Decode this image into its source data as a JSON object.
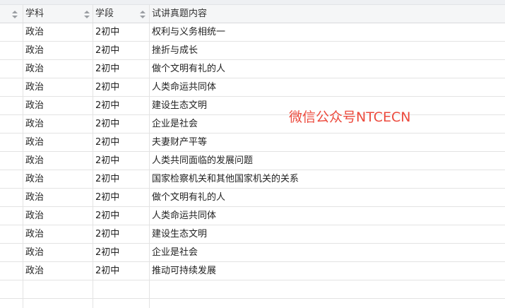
{
  "table": {
    "columns": [
      "",
      "学科",
      "学段",
      "试讲真题内容"
    ],
    "rows": [
      {
        "subject": "政治",
        "level": "2初中",
        "topic": "权利与义务相统一"
      },
      {
        "subject": "政治",
        "level": "2初中",
        "topic": "挫折与成长"
      },
      {
        "subject": "政治",
        "level": "2初中",
        "topic": "做个文明有礼的人"
      },
      {
        "subject": "政治",
        "level": "2初中",
        "topic": "人类命运共同体"
      },
      {
        "subject": "政治",
        "level": "2初中",
        "topic": "建设生态文明"
      },
      {
        "subject": "政治",
        "level": "2初中",
        "topic": "企业是社会"
      },
      {
        "subject": "政治",
        "level": "2初中",
        "topic": "夫妻财产平等"
      },
      {
        "subject": "政治",
        "level": "2初中",
        "topic": "人类共同面临的发展问题"
      },
      {
        "subject": "政治",
        "level": "2初中",
        "topic": "国家检察机关和其他国家机关的关系"
      },
      {
        "subject": "政治",
        "level": "2初中",
        "topic": "做个文明有礼的人"
      },
      {
        "subject": "政治",
        "level": "2初中",
        "topic": "人类命运共同体"
      },
      {
        "subject": "政治",
        "level": "2初中",
        "topic": "建设生态文明"
      },
      {
        "subject": "政治",
        "level": "2初中",
        "topic": "企业是社会"
      },
      {
        "subject": "政治",
        "level": "2初中",
        "topic": "推动可持续发展"
      }
    ],
    "empty_rows": 2
  },
  "watermark": "微信公众号NTCECN",
  "colors": {
    "header_bg": "#f5f6f7",
    "grid_line": "#e3e3e3",
    "watermark": "#ec4a3d",
    "sort_icon": "#9a9da2"
  },
  "icons": [
    "sort-icon"
  ]
}
